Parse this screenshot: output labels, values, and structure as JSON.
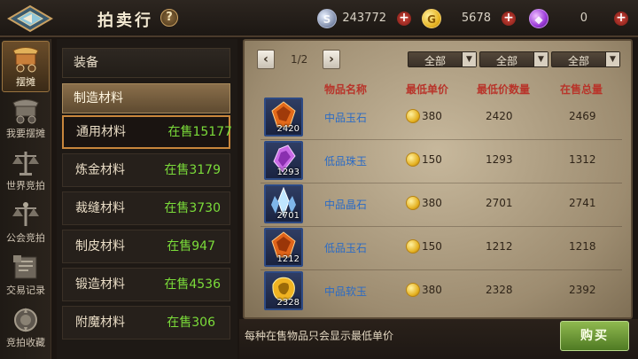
{
  "header": {
    "title": "拍卖行",
    "help": "?",
    "currencies": [
      {
        "type": "silver",
        "value": "243772",
        "plus": "+"
      },
      {
        "type": "gold",
        "value": "5678",
        "plus": "+"
      },
      {
        "type": "gem",
        "value": "0",
        "plus": "+"
      }
    ]
  },
  "nav": [
    {
      "label": "摆摊",
      "icon": "cart-icon",
      "active": true
    },
    {
      "label": "我要摆摊",
      "icon": "stall-icon",
      "active": false
    },
    {
      "label": "世界竞拍",
      "icon": "scales-icon",
      "active": false
    },
    {
      "label": "公会竞拍",
      "icon": "guild-scales-icon",
      "active": false
    },
    {
      "label": "交易记录",
      "icon": "record-book-icon",
      "active": false
    },
    {
      "label": "竞拍收藏",
      "icon": "favorite-icon",
      "active": false
    }
  ],
  "categories": {
    "equip": "装备",
    "material": "制造材料",
    "items": [
      {
        "name": "通用材料",
        "count": "在售15177"
      },
      {
        "name": "炼金材料",
        "count": "在售3179"
      },
      {
        "name": "裁缝材料",
        "count": "在售3730"
      },
      {
        "name": "制皮材料",
        "count": "在售947"
      },
      {
        "name": "锻造材料",
        "count": "在售4536"
      },
      {
        "name": "附魔材料",
        "count": "在售306"
      }
    ]
  },
  "market": {
    "page": "1/2",
    "prev": "‹",
    "next": "›",
    "filters": [
      "全部",
      "全部",
      "全部"
    ],
    "filter_arrow": "▼",
    "headers": [
      "物品名称",
      "最低单价",
      "最低价数量",
      "在售总量"
    ],
    "rows": [
      {
        "name": "中品玉石",
        "qty": "2420",
        "price": "380",
        "low_qty": "2420",
        "total": "2469",
        "gem": "orange"
      },
      {
        "name": "低品珠玉",
        "qty": "1293",
        "price": "150",
        "low_qty": "1293",
        "total": "1312",
        "gem": "purple"
      },
      {
        "name": "中品晶石",
        "qty": "2701",
        "price": "380",
        "low_qty": "2701",
        "total": "2741",
        "gem": "blue"
      },
      {
        "name": "低品玉石",
        "qty": "1212",
        "price": "150",
        "low_qty": "1212",
        "total": "1218",
        "gem": "orange"
      },
      {
        "name": "中品软玉",
        "qty": "2328",
        "price": "380",
        "low_qty": "2328",
        "total": "2392",
        "gem": "yellow"
      }
    ],
    "notice": "每种在售物品只会显示最低单价",
    "buy": "购买"
  },
  "colors": {
    "accent": "#c8863c",
    "count_green": "#7bdc3a",
    "header_red": "#b8342a",
    "link_blue": "#2b6bc5"
  }
}
